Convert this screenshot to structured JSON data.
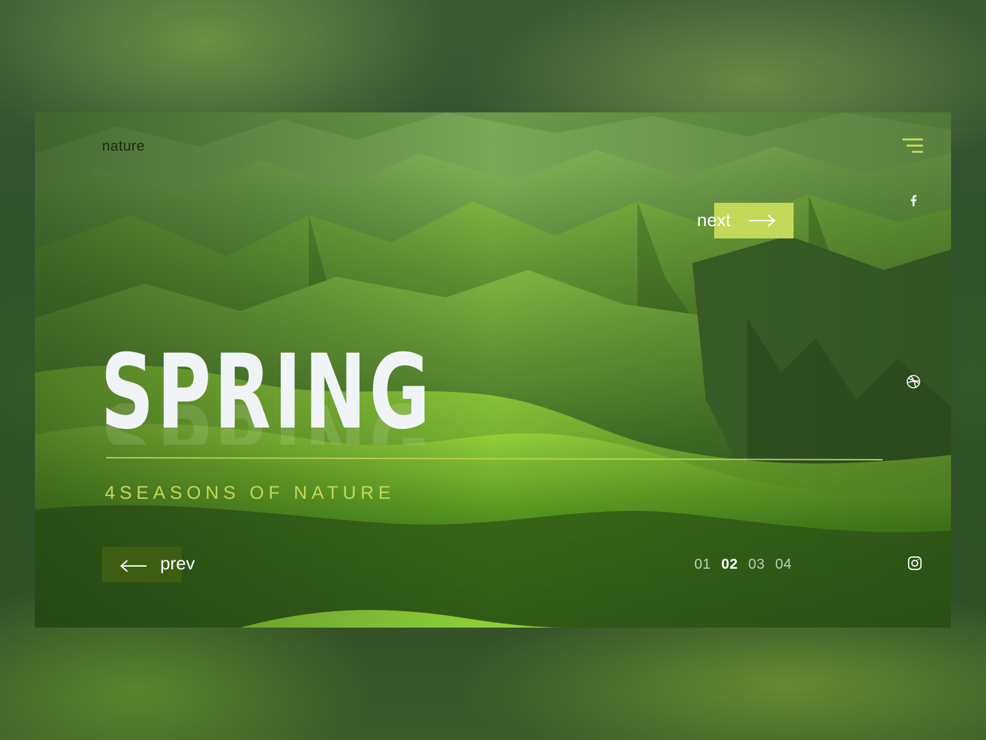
{
  "brand": {
    "name": "nature"
  },
  "hero": {
    "title": "SPRING",
    "subtitle": "4SEASONS OF NATURE"
  },
  "nav": {
    "next_label": "next",
    "prev_label": "prev"
  },
  "pagination": {
    "pages": [
      "01",
      "02",
      "03",
      "04"
    ],
    "active": "02"
  },
  "social": [
    "facebook-icon",
    "dribbble-icon",
    "instagram-icon"
  ],
  "icons": {
    "menu": "hamburger-menu-icon",
    "next": "arrow-right-icon",
    "prev": "arrow-left-icon"
  },
  "colors": {
    "accent": "#c3d858",
    "prev_button": "#3d5e12",
    "title": "#f1f4f7",
    "brand_text": "#1c2a14"
  }
}
